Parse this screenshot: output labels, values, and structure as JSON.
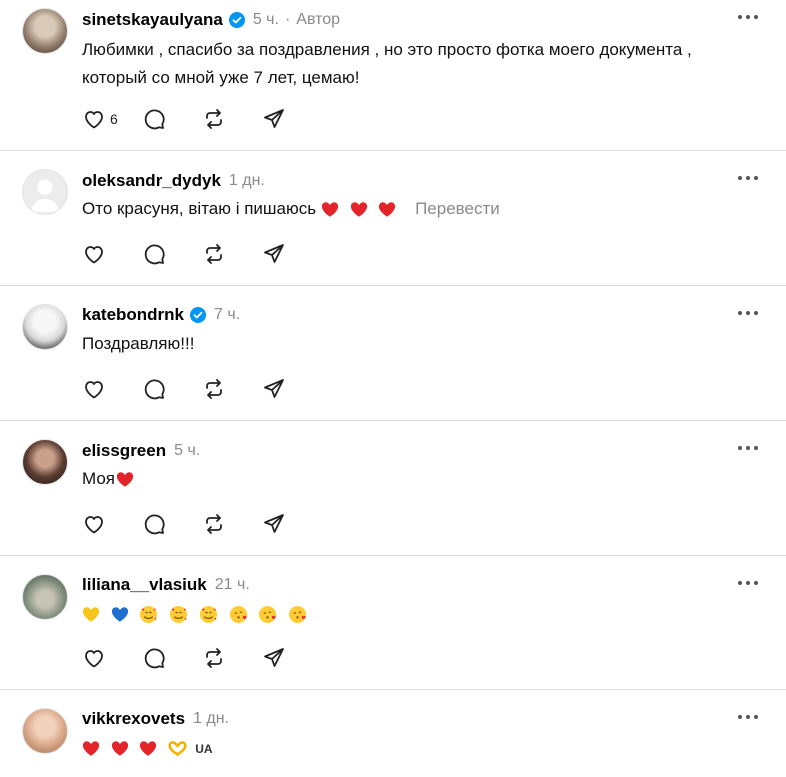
{
  "posts": [
    {
      "username": "sinetskayaulyana",
      "verified": true,
      "time": "5 ч.",
      "dot": "·",
      "author_label": "Автор",
      "text_lines": [
        "Любимки , спасибо за поздравления , но это просто фотка моего документа ,",
        "который со мной уже 7 лет, цемаю!"
      ],
      "like_count": "6"
    },
    {
      "username": "oleksandr_dydyk",
      "verified": false,
      "time": "1 дн.",
      "text": "Ото красуня, вітаю і пишаюсь",
      "emojis": [
        "red-heart",
        "red-heart",
        "red-heart"
      ],
      "translate_label": "Перевести"
    },
    {
      "username": "katebondrnk",
      "verified": true,
      "time": "7 ч.",
      "text": "Поздравляю!!!"
    },
    {
      "username": "elissgreen",
      "verified": false,
      "time": "5 ч.",
      "text": "Моя",
      "emojis": [
        "red-heart"
      ]
    },
    {
      "username": "liliana__vlasiuk",
      "verified": false,
      "time": "21 ч.",
      "emojis": [
        "yellow-heart",
        "blue-heart",
        "smiling-face-with-hearts",
        "smiling-face-with-hearts",
        "smiling-face-with-hearts",
        "face-blowing-kiss",
        "face-blowing-kiss",
        "face-blowing-kiss"
      ]
    },
    {
      "username": "vikkrexovets",
      "verified": false,
      "time": "1 дн.",
      "emojis": [
        "red-heart",
        "red-heart",
        "red-heart",
        "heart-hands"
      ],
      "trailing_text": "UA"
    }
  ],
  "colors": {
    "verified_blue": "#0095f6",
    "muted_text": "#8a8a8a",
    "divider": "#dcdcdc",
    "heart_red": "#e3242b"
  }
}
